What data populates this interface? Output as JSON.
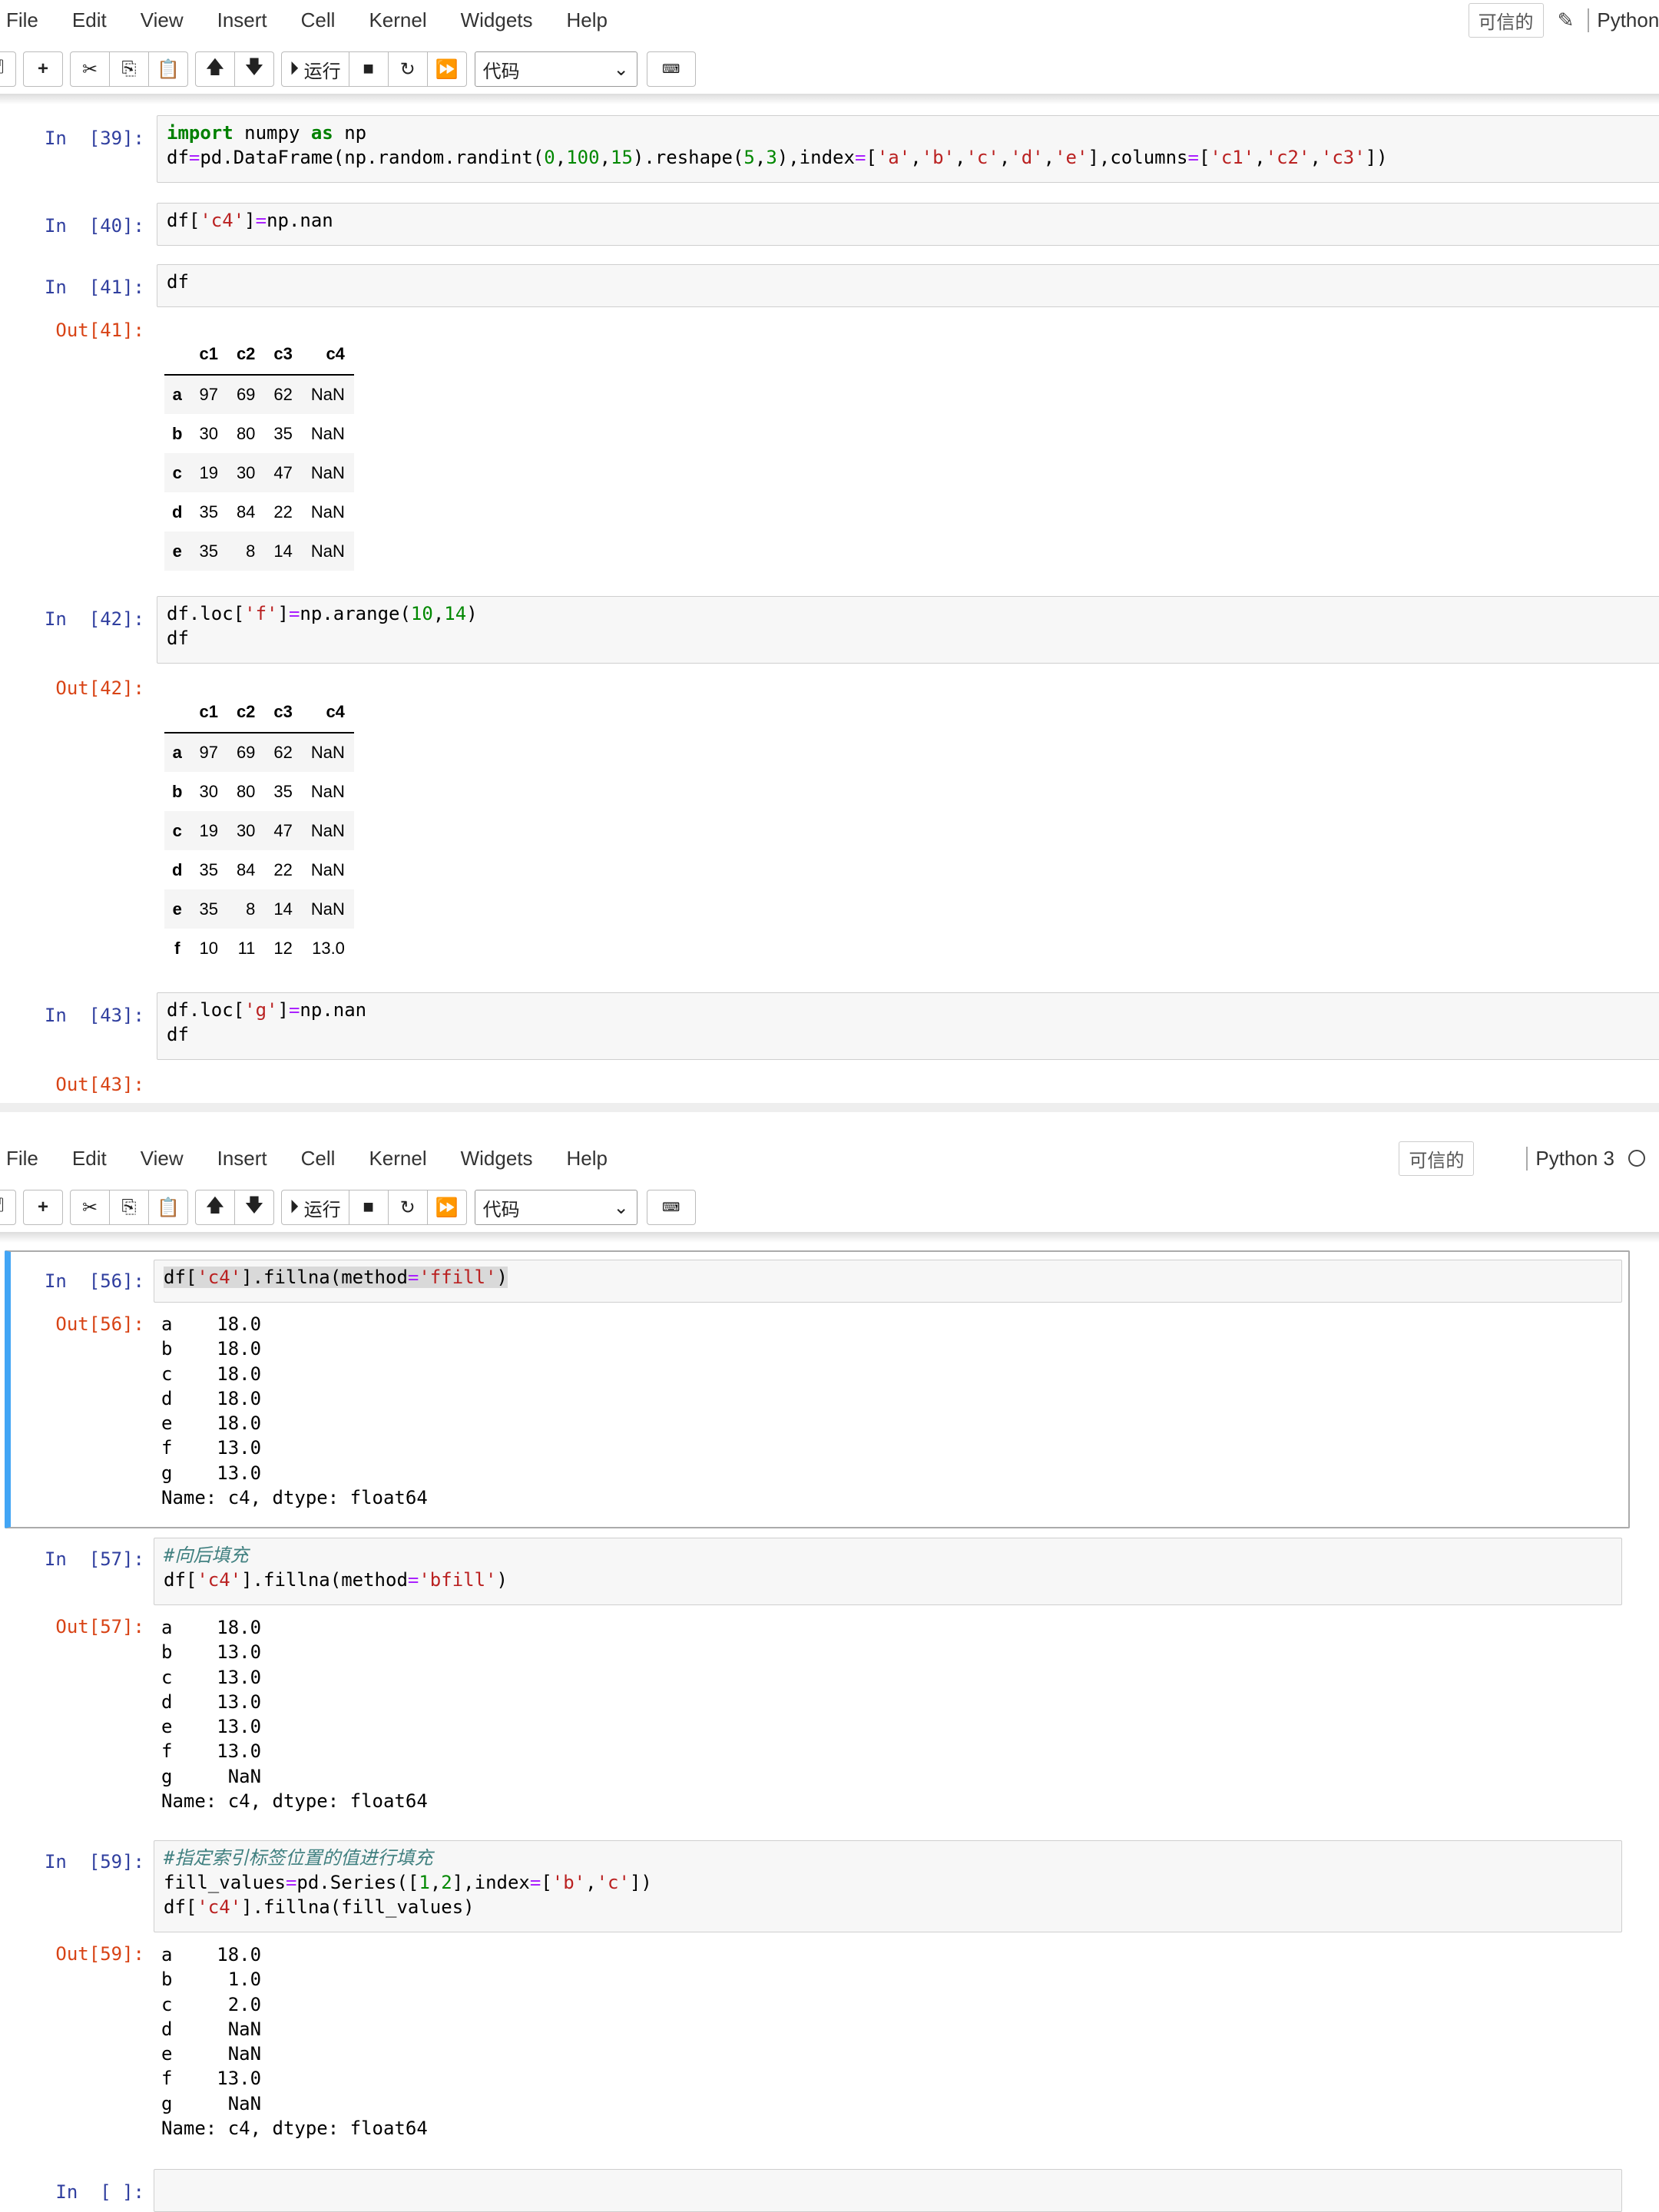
{
  "menu": [
    "File",
    "Edit",
    "View",
    "Insert",
    "Cell",
    "Kernel",
    "Widgets",
    "Help"
  ],
  "trusted": "可信的",
  "kernel_name": "Python 3",
  "run_label": "运行",
  "cell_type": "代码",
  "pane1": {
    "cells": [
      {
        "in": "In  [39]:",
        "code_html": "<span class=\"kw\">import</span> numpy <span class=\"kw\">as</span> np\ndf<span class=\"op\">=</span>pd.DataFrame(np.random.randint(<span class=\"nu\">0</span>,<span class=\"nu\">100</span>,<span class=\"nu\">15</span>).reshape(<span class=\"nu\">5</span>,<span class=\"nu\">3</span>),index<span class=\"op\">=</span>[<span class=\"st\">'a'</span>,<span class=\"st\">'b'</span>,<span class=\"st\">'c'</span>,<span class=\"st\">'d'</span>,<span class=\"st\">'e'</span>],columns<span class=\"op\">=</span>[<span class=\"st\">'c1'</span>,<span class=\"st\">'c2'</span>,<span class=\"st\">'c3'</span>])"
      },
      {
        "in": "In  [40]:",
        "code_html": "df[<span class=\"st\">'c4'</span>]<span class=\"op\">=</span>np.nan"
      },
      {
        "in": "In  [41]:",
        "code_html": "df"
      },
      {
        "in": "In  [42]:",
        "code_html": "df.loc[<span class=\"st\">'f'</span>]<span class=\"op\">=</span>np.arange(<span class=\"nu\">10</span>,<span class=\"nu\">14</span>)\ndf"
      },
      {
        "in": "In  [43]:",
        "code_html": "df.loc[<span class=\"st\">'g'</span>]<span class=\"op\">=</span>np.nan\ndf"
      }
    ],
    "out41": "Out[41]:",
    "out42": "Out[42]:",
    "out43": "Out[43]:",
    "df_columns": [
      "",
      "c1",
      "c2",
      "c3",
      "c4"
    ],
    "df41": [
      [
        "a",
        "97",
        "69",
        "62",
        "NaN"
      ],
      [
        "b",
        "30",
        "80",
        "35",
        "NaN"
      ],
      [
        "c",
        "19",
        "30",
        "47",
        "NaN"
      ],
      [
        "d",
        "35",
        "84",
        "22",
        "NaN"
      ],
      [
        "e",
        "35",
        "8",
        "14",
        "NaN"
      ]
    ],
    "df42": [
      [
        "a",
        "97",
        "69",
        "62",
        "NaN"
      ],
      [
        "b",
        "30",
        "80",
        "35",
        "NaN"
      ],
      [
        "c",
        "19",
        "30",
        "47",
        "NaN"
      ],
      [
        "d",
        "35",
        "84",
        "22",
        "NaN"
      ],
      [
        "e",
        "35",
        "8",
        "14",
        "NaN"
      ],
      [
        "f",
        "10",
        "11",
        "12",
        "13.0"
      ]
    ]
  },
  "pane2": {
    "cells": [
      {
        "in": "In  [56]:",
        "code_html": "<span class=\"hl\">df[<span class=\"st\">'c4'</span>].fillna(method<span class=\"op\">=</span><span class=\"st\">'ffill'</span>)</span>"
      },
      {
        "in": "In  [57]:",
        "code_html": "<span class=\"cm\">#向后填充</span>\ndf[<span class=\"st\">'c4'</span>].fillna(method<span class=\"op\">=</span><span class=\"st\">'bfill'</span>)"
      },
      {
        "in": "In  [59]:",
        "code_html": "<span class=\"cm\">#指定索引标签位置的值进行填充</span>\nfill_values<span class=\"op\">=</span>pd.Series([<span class=\"nu\">1</span>,<span class=\"nu\">2</span>],index<span class=\"op\">=</span>[<span class=\"st\">'b'</span>,<span class=\"st\">'c'</span>])\ndf[<span class=\"st\">'c4'</span>].fillna(fill_values)"
      },
      {
        "in": "In  [ ]:",
        "code_html": ""
      }
    ],
    "out56": "Out[56]:",
    "out57": "Out[57]:",
    "out59": "Out[59]:",
    "text56": "a    18.0\nb    18.0\nc    18.0\nd    18.0\ne    18.0\nf    13.0\ng    13.0\nName: c4, dtype: float64",
    "text57": "a    18.0\nb    13.0\nc    13.0\nd    13.0\ne    13.0\nf    13.0\ng     NaN\nName: c4, dtype: float64",
    "text59": "a    18.0\nb     1.0\nc     2.0\nd     NaN\ne     NaN\nf    13.0\ng     NaN\nName: c4, dtype: float64"
  }
}
